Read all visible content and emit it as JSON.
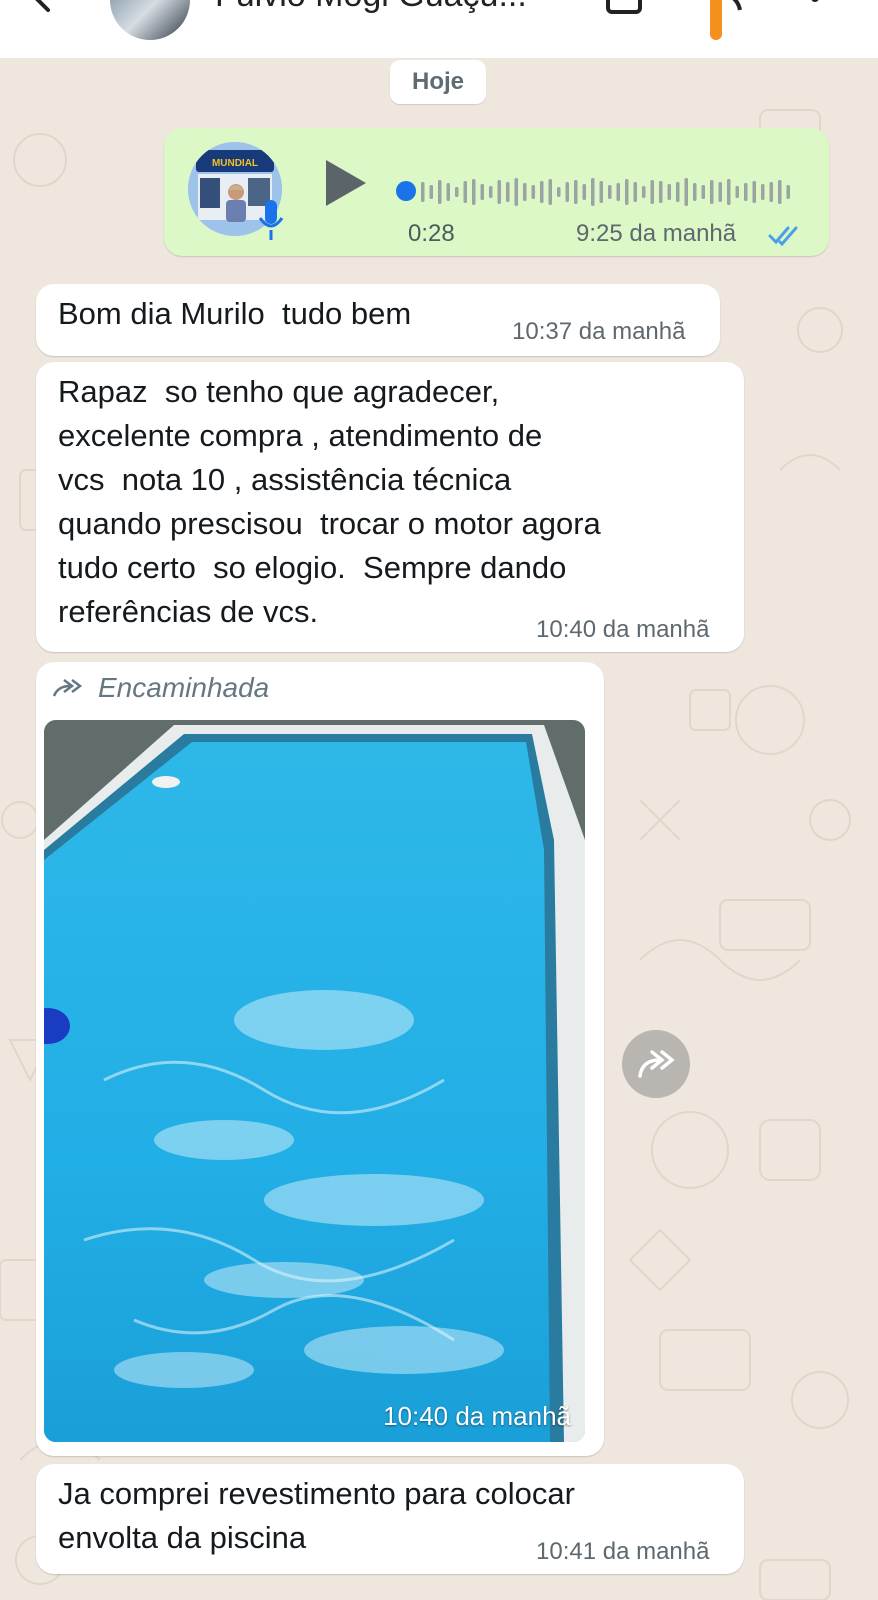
{
  "header": {
    "contact_name": "Fulvio Mogi Guaçu...",
    "accent_color": "#f4901e"
  },
  "chat": {
    "date_label": "Hoje",
    "voice_message": {
      "duration": "0:28",
      "time": "9:25 da manhã",
      "status": "read",
      "avatar_sign_text": "MUNDIAL"
    },
    "messages": [
      {
        "lines": [
          "Bom dia Murilo  tudo bem"
        ],
        "time": "10:37 da manhã"
      },
      {
        "lines": [
          "Rapaz  so tenho que agradecer,",
          "excelente compra , atendimento de",
          "vcs  nota 10 , assistência técnica",
          "quando prescisou  trocar o motor agora",
          "tudo certo  so elogio.  Sempre dando",
          "referências de vcs."
        ],
        "time": "10:40 da manhã"
      },
      {
        "lines": [
          "Ja comprei revestimento para colocar",
          "envolta da piscina"
        ],
        "time": "10:41 da manhã"
      }
    ],
    "photo_message": {
      "forwarded_label": "Encaminhada",
      "time": "10:40 da manhã"
    }
  },
  "colors": {
    "outgoing_bubble": "#dcf8c6",
    "incoming_bubble": "#ffffff",
    "wallpaper": "#efe7de",
    "read_ticks": "#4a9fe8"
  }
}
